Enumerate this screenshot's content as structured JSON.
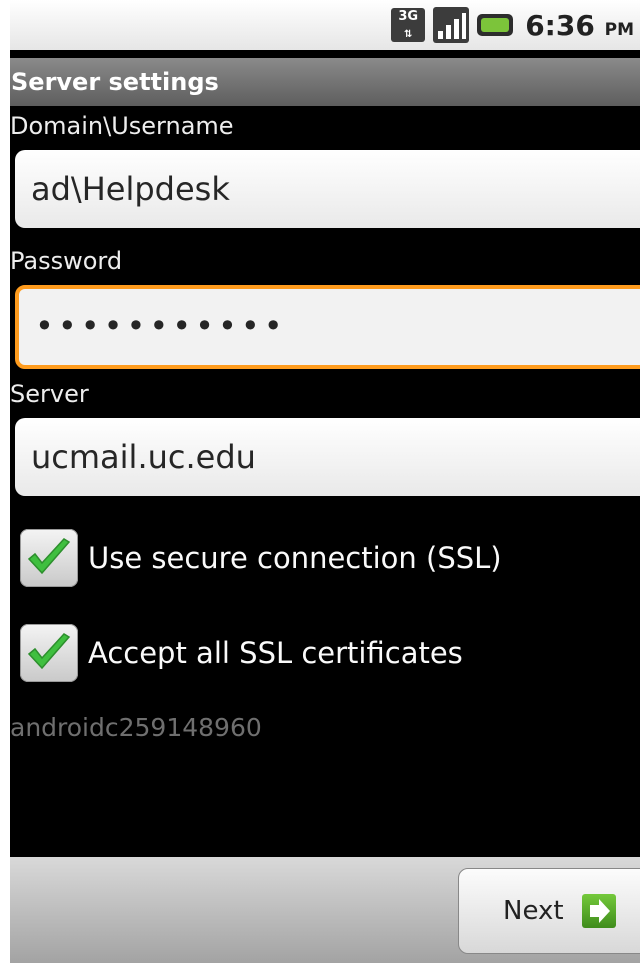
{
  "status_bar": {
    "network": "3G",
    "time": "6:36",
    "ampm": "PM"
  },
  "title": "Server settings",
  "form": {
    "username_label": "Domain\\Username",
    "username_value": "ad\\Helpdesk",
    "password_label": "Password",
    "password_value": "•••••••••••",
    "server_label": "Server",
    "server_value": "ucmail.uc.edu"
  },
  "options": {
    "ssl_label": "Use secure connection (SSL)",
    "ssl_checked": true,
    "certs_label": "Accept all SSL certificates",
    "certs_checked": true
  },
  "device_id": "androidc259148960",
  "buttons": {
    "next_label": "Next"
  },
  "colors": {
    "focus_border": "#ff9c1e",
    "check_green": "#3fbf3f"
  }
}
